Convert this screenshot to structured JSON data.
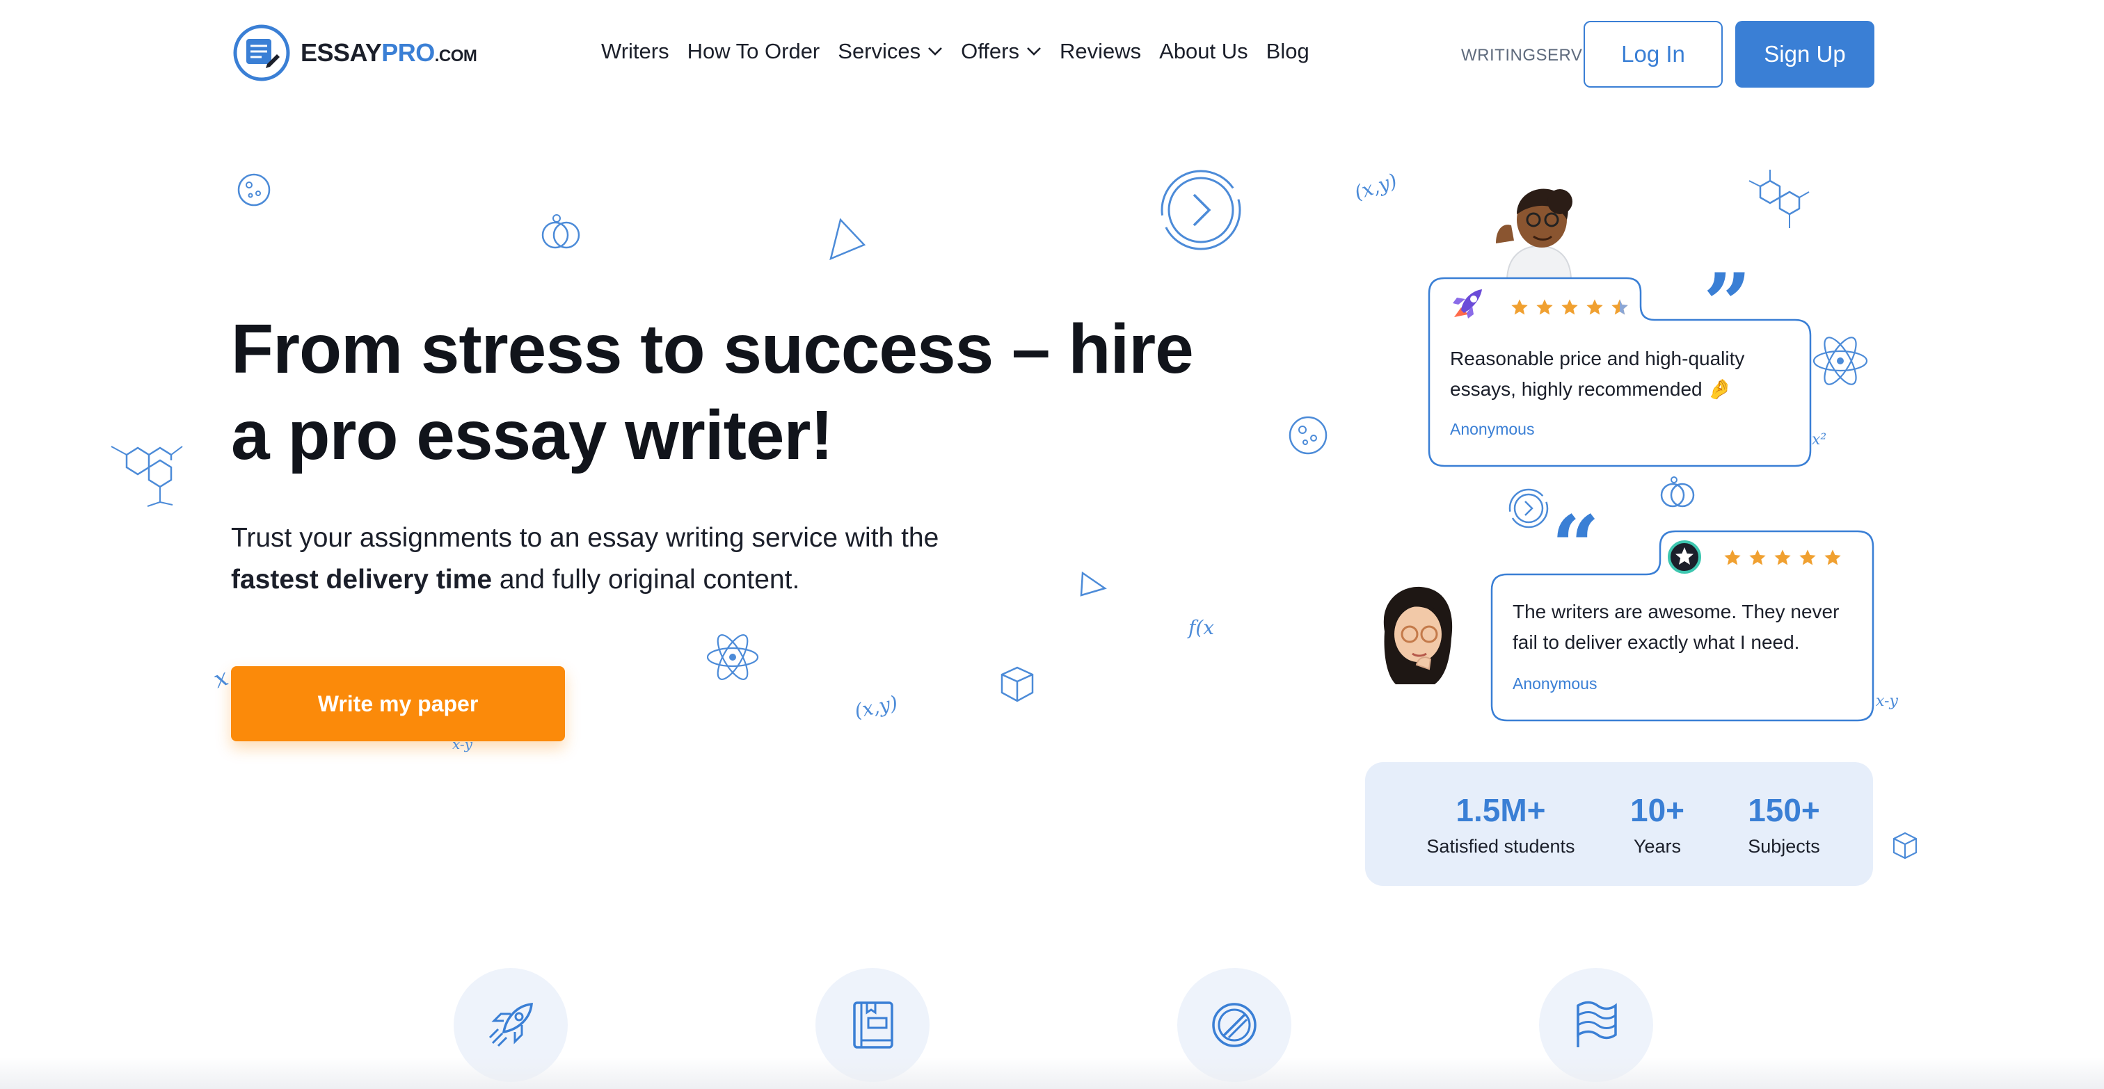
{
  "header": {
    "logo": {
      "essay": "ESSAY",
      "pro": "PRO",
      "com": ".COM"
    },
    "nav": [
      {
        "label": "Writers",
        "dropdown": false
      },
      {
        "label": "How To Order",
        "dropdown": false
      },
      {
        "label": "Services",
        "dropdown": true
      },
      {
        "label": "Offers",
        "dropdown": true
      },
      {
        "label": "Reviews",
        "dropdown": false
      },
      {
        "label": "About Us",
        "dropdown": false
      },
      {
        "label": "Blog",
        "dropdown": false
      }
    ],
    "promo_code": "WRITINGSERV",
    "login_label": "Log In",
    "signup_label": "Sign Up"
  },
  "hero": {
    "title": "From stress to success – hire a pro essay writer!",
    "subtitle_part1": "Trust your assignments to an essay writing service with the",
    "subtitle_bold": "fastest delivery time",
    "subtitle_part2": "and fully original content.",
    "cta_label": "Write my paper"
  },
  "reviews": [
    {
      "rating": 5,
      "text": "Reasonable price and high-quality essays, highly recommended 🤌",
      "author": "Anonymous",
      "badge_icon": "rocket-icon"
    },
    {
      "rating": 5,
      "text": "The writers are awesome. They never fail to deliver exactly what I need.",
      "author": "Anonymous",
      "badge_icon": "star-badge-icon"
    }
  ],
  "stats": [
    {
      "value": "1.5M+",
      "label": "Satisfied students"
    },
    {
      "value": "10+",
      "label": "Years"
    },
    {
      "value": "150+",
      "label": "Subjects"
    }
  ],
  "doodle_text": {
    "xy": "(x,y)",
    "fx": "f(x",
    "xminusy": "x-y",
    "x2": "x²",
    "x": "x"
  },
  "features": [
    {
      "icon": "rocket-icon"
    },
    {
      "icon": "book-icon"
    },
    {
      "icon": "no-plagiarism-icon"
    },
    {
      "icon": "flag-icon"
    }
  ],
  "colors": {
    "brand_blue": "#3a7fd5",
    "cta_orange": "#fb8a0a",
    "star_orange": "#f0a030",
    "stats_bg": "#e6eefa"
  }
}
